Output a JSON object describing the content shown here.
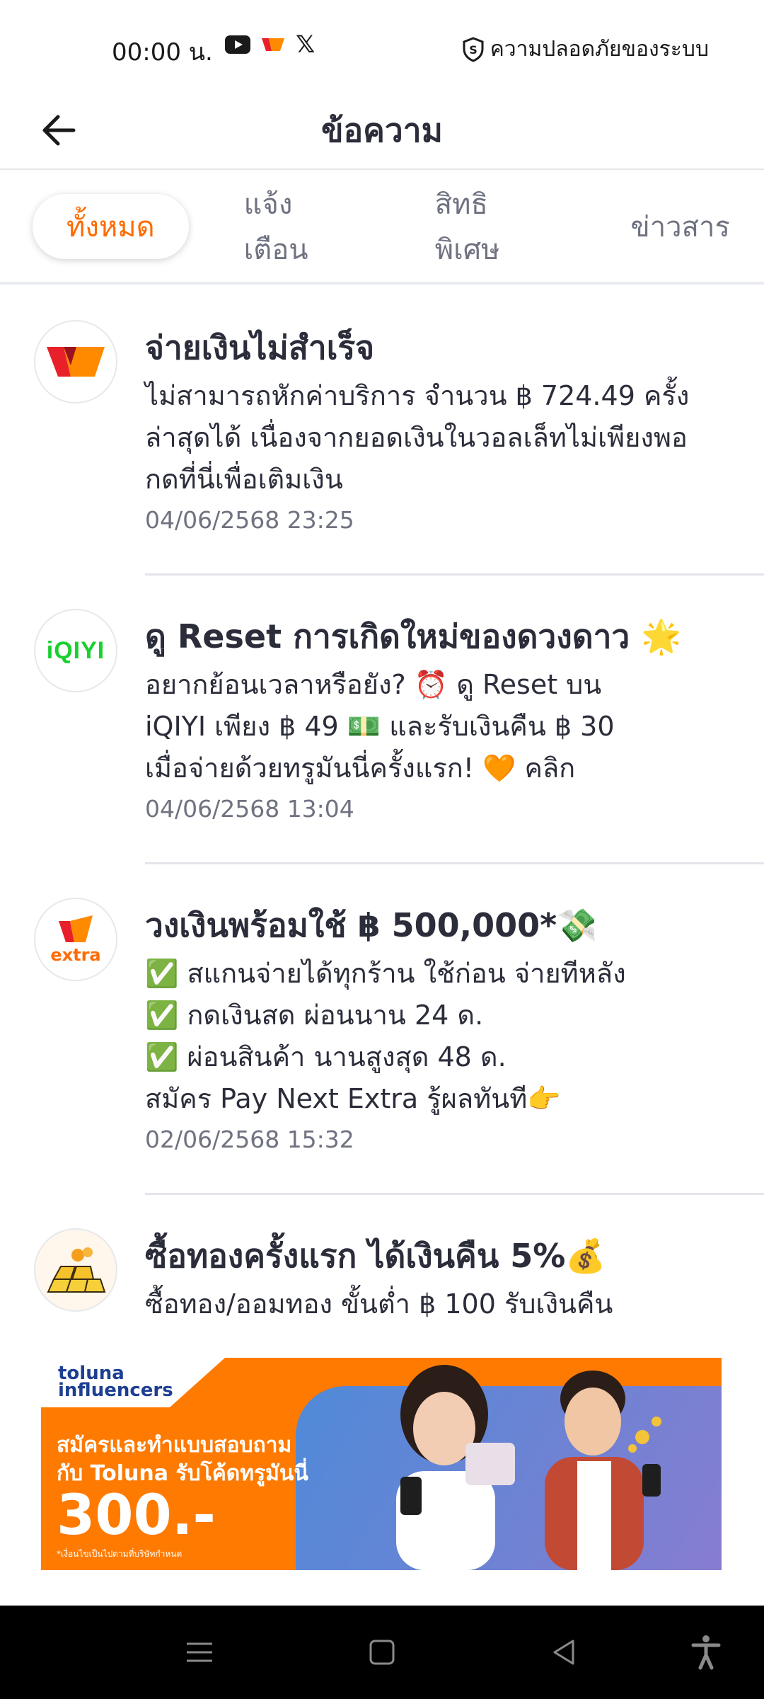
{
  "status_bar": {
    "time": "00:00 น.",
    "security_text": "ความปลอดภัยของระบบ",
    "icons": [
      "youtube-icon",
      "truemoney-icon",
      "x-icon",
      "shield-icon"
    ]
  },
  "header": {
    "title": "ข้อความ",
    "back_icon": "arrow-left-icon"
  },
  "tabs": [
    {
      "label": "ทั้งหมด",
      "active": true
    },
    {
      "label": "แจ้งเตือน",
      "active": false
    },
    {
      "label": "สิทธิพิเศษ",
      "active": false
    },
    {
      "label": "ข่าวสาร",
      "active": false
    }
  ],
  "messages": [
    {
      "title": "จ่ายเงินไม่สำเร็จ",
      "body": "ไม่สามารถหักค่าบริการ จำนวน ฿ 724.49 ครั้งล่าสุดได้ เนื่องจากยอดเงินในวอลเล็ทไม่เพียงพอ กดที่นี่เพื่อเติมเงิน",
      "date": "04/06/2568 23:25",
      "avatar": "truemoney-logo"
    },
    {
      "title": "ดู Reset การเกิดใหม่ของดวงดาว 🌟",
      "body": "อยากย้อนเวลาหรือยัง? ⏰ ดู Reset บน\niQIYI เพียง ฿ 49 💵 และรับเงินคืน ฿ 30\nเมื่อจ่ายด้วยทรูมันนี่ครั้งแรก! 🧡 คลิก",
      "date": "04/06/2568 13:04",
      "avatar": "iqiyi-logo",
      "avatar_text": "iQIYI"
    },
    {
      "title": "วงเงินพร้อมใช้ ฿ 500,000*💸",
      "body": "✅ สแกนจ่ายได้ทุกร้าน ใช้ก่อน จ่ายทีหลัง\n✅ กดเงินสด ผ่อนนาน 24 ด.\n✅ ผ่อนสินค้า นานสูงสุด 48 ด.\nสมัคร Pay Next Extra รู้ผลทันที👉",
      "date": "02/06/2568 15:32",
      "avatar": "paynext-extra-logo",
      "avatar_text": "extra"
    },
    {
      "title": "ซื้อทองครั้งแรก ได้เงินคืน 5%💰",
      "body": "ซื้อทอง/ออมทอง ขั้นต่ำ ฿ 100 รับเงินคืน",
      "date": "",
      "avatar": "gold-bars-icon"
    }
  ],
  "banner": {
    "brand_line1": "toluna",
    "brand_line2": "influencers",
    "line1": "สมัครและทำแบบสอบถาม",
    "line2": "กับ Toluna รับโค้ดทรูมันนี่",
    "amount": "300.-",
    "note": "*เงื่อนไขเป็นไปตามที่บริษัทกำหนด"
  },
  "colors": {
    "accent": "#ff6b00",
    "text": "#2b2d3a",
    "muted": "#6f7280",
    "iqiyi_green": "#1ad02e"
  }
}
